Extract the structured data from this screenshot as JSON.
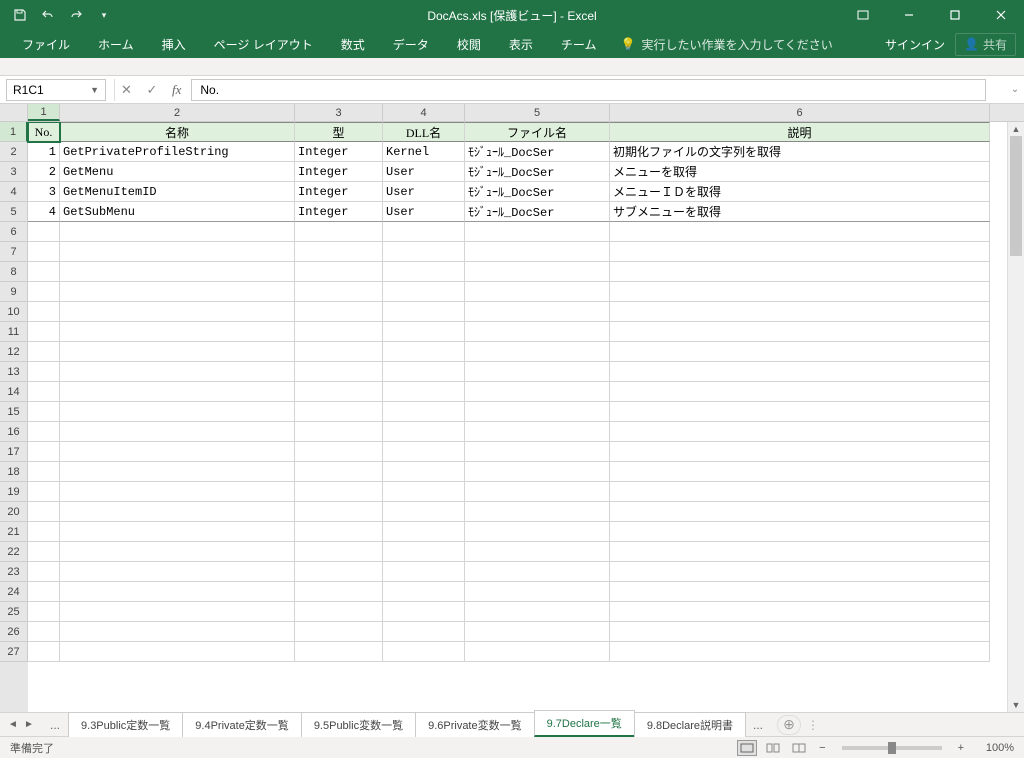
{
  "title": "DocAcs.xls  [保護ビュー] - Excel",
  "qat": {
    "save": "save",
    "undo": "undo",
    "redo": "redo"
  },
  "win": {
    "signin": "サインイン",
    "share": "共有"
  },
  "ribbon": {
    "tabs": [
      "ファイル",
      "ホーム",
      "挿入",
      "ページ レイアウト",
      "数式",
      "データ",
      "校閲",
      "表示",
      "チーム"
    ],
    "tellme": "実行したい作業を入力してください"
  },
  "formula": {
    "namebox": "R1C1",
    "value": "No."
  },
  "columns": [
    "1",
    "2",
    "3",
    "4",
    "5",
    "6"
  ],
  "headers": {
    "no": "No.",
    "name": "名称",
    "type": "型",
    "dll": "DLL名",
    "file": "ファイル名",
    "desc": "説明"
  },
  "rows": [
    {
      "no": "1",
      "name": "GetPrivateProfileString",
      "type": "Integer",
      "dll": "Kernel",
      "file": "ﾓｼﾞｭｰﾙ_DocSer",
      "desc": "初期化ファイルの文字列を取得"
    },
    {
      "no": "2",
      "name": "GetMenu",
      "type": "Integer",
      "dll": "User",
      "file": "ﾓｼﾞｭｰﾙ_DocSer",
      "desc": "メニューを取得"
    },
    {
      "no": "3",
      "name": "GetMenuItemID",
      "type": "Integer",
      "dll": "User",
      "file": "ﾓｼﾞｭｰﾙ_DocSer",
      "desc": "メニューＩＤを取得"
    },
    {
      "no": "4",
      "name": "GetSubMenu",
      "type": "Integer",
      "dll": "User",
      "file": "ﾓｼﾞｭｰﾙ_DocSer",
      "desc": "サブメニューを取得"
    }
  ],
  "sheets": [
    "9.3Public定数一覧",
    "9.4Private定数一覧",
    "9.5Public変数一覧",
    "9.6Private変数一覧",
    "9.7Declare一覧",
    "9.8Declare説明書"
  ],
  "active_sheet": 4,
  "status": {
    "ready": "準備完了",
    "zoom": "100%"
  }
}
